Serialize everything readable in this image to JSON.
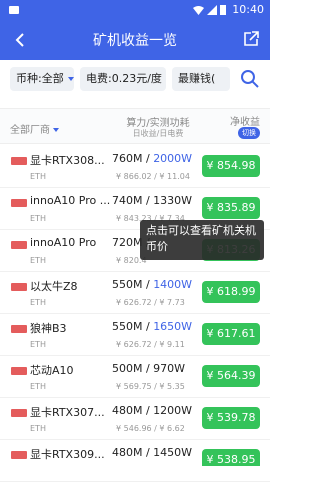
{
  "status_bar": {
    "time": "10:40"
  },
  "header": {
    "title": "矿机收益一览"
  },
  "filters": {
    "currency": "币种:全部",
    "electricity": "电费:0.23元/度",
    "sort": "最赚钱("
  },
  "table_header": {
    "manufacturer": "全部厂商",
    "hashrate": "算力/实测功耗",
    "hashrate_sub": "日收益/日电费",
    "net": "净收益",
    "switch": "切换"
  },
  "rows": [
    {
      "name": "显卡RTX308...",
      "coin": "ETH",
      "hashrate": "760M / ",
      "power": "2000W",
      "sub": "¥ 866.02 / ¥ 11.04",
      "profit": "¥ 854.98",
      "logo": "gpu-logo"
    },
    {
      "name": "innoA10 Pro ...",
      "coin": "ETH",
      "hashrate": "740M / 1330W",
      "power": "",
      "sub": "¥ 843.23 / ¥ 7.34",
      "profit": "¥ 835.89",
      "logo": "inno-logo"
    },
    {
      "name": "innoA10 Pro",
      "coin": "ETH",
      "hashrate": "720M / ",
      "power": "",
      "sub": "¥ 820.4",
      "profit": "¥ 813.26",
      "logo": "inno-logo"
    },
    {
      "name": "以太牛Z8",
      "coin": "ETH",
      "hashrate": "550M / ",
      "power": "1400W",
      "sub": "¥ 626.72 / ¥ 7.73",
      "profit": "¥ 618.99",
      "logo": "bull-logo"
    },
    {
      "name": "狼神B3",
      "coin": "ETH",
      "hashrate": "550M / ",
      "power": "1650W",
      "sub": "¥ 626.72 / ¥ 9.11",
      "profit": "¥ 617.61",
      "logo": "wolf-logo"
    },
    {
      "name": "芯动A10",
      "coin": "ETH",
      "hashrate": "500M / 970W",
      "power": "",
      "sub": "¥ 569.75 / ¥ 5.35",
      "profit": "¥ 564.39",
      "logo": "chip-logo"
    },
    {
      "name": "显卡RTX307...",
      "coin": "ETH",
      "hashrate": "480M / 1200W",
      "power": "",
      "sub": "¥ 546.96 / ¥ 6.62",
      "profit": "¥ 539.78",
      "logo": "gpu-logo"
    },
    {
      "name": "显卡RTX309...",
      "coin": "ETH",
      "hashrate": "480M / 1450W",
      "power": "",
      "sub": "¥ 546.96 / ¥ 8.01",
      "profit": "¥ 538.95",
      "logo": "gpu-logo"
    }
  ],
  "tooltip": {
    "text": "点击可以查看矿机关机币价"
  }
}
